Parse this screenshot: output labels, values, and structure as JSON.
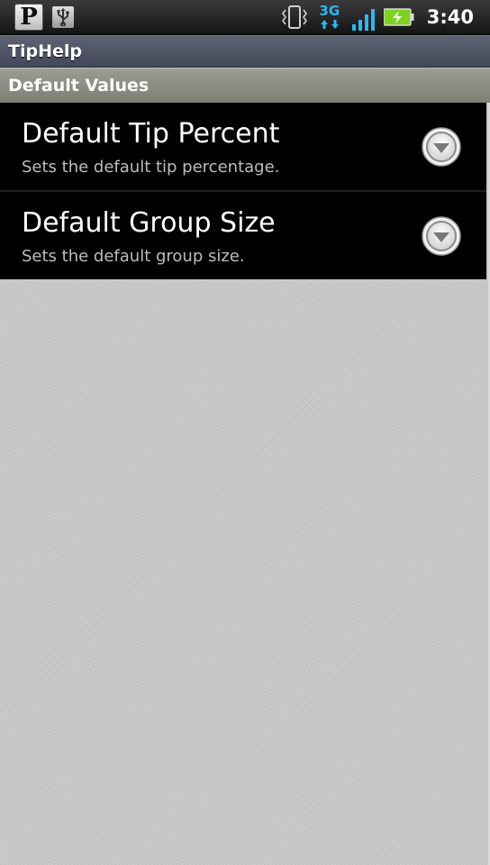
{
  "status_bar": {
    "left_icons": [
      "pandora-icon",
      "usb-icon"
    ],
    "pandora_letter": "P",
    "right_icons": [
      "vibrate-icon",
      "3g-icon",
      "signal-icon",
      "battery-charging-icon"
    ],
    "network_type": "3G",
    "time": "3:40"
  },
  "app": {
    "title": "TipHelp"
  },
  "section": {
    "title": "Default Values"
  },
  "preferences": [
    {
      "title": "Default Tip Percent",
      "summary": "Sets the default tip percentage.",
      "icon": "dropdown-arrow-icon"
    },
    {
      "title": "Default Group Size",
      "summary": "Sets the default group size.",
      "icon": "dropdown-arrow-icon"
    }
  ],
  "colors": {
    "network_accent": "#2fb7f0",
    "battery_green": "#7ed321",
    "title_bar": "#4b5060",
    "section_header": "#8b8c82"
  }
}
